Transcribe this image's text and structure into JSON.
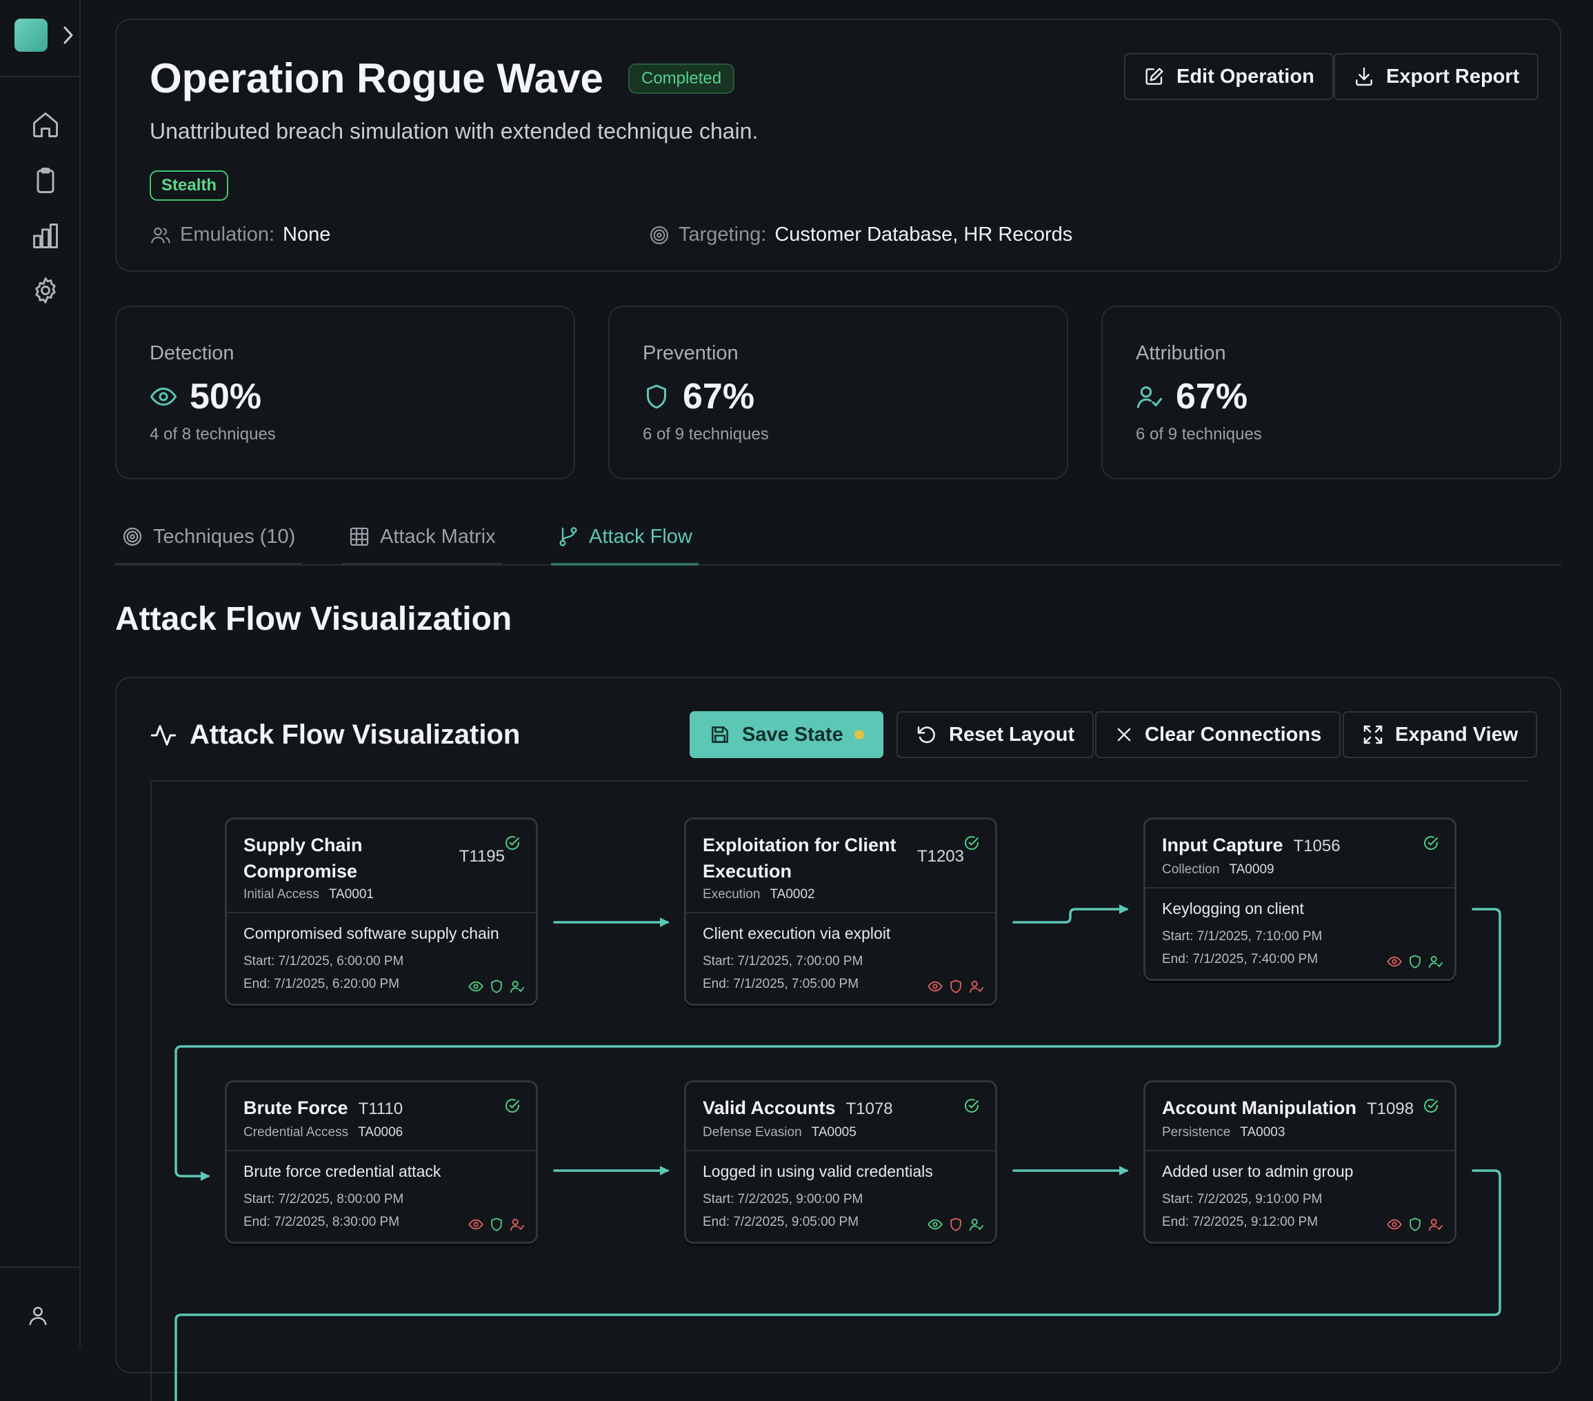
{
  "operation": {
    "title": "Operation Rogue Wave",
    "status": "Completed",
    "description": "Unattributed breach simulation with extended technique chain.",
    "tag": "Stealth",
    "emulation_label": "Emulation:",
    "emulation_value": "None",
    "targeting_label": "Targeting:",
    "targeting_value": "Customer Database, HR Records",
    "edit_label": "Edit Operation",
    "export_label": "Export Report"
  },
  "stats": [
    {
      "label": "Detection",
      "value": "50%",
      "sub": "4 of 8 techniques",
      "icon": "eye-icon"
    },
    {
      "label": "Prevention",
      "value": "67%",
      "sub": "6 of 9 techniques",
      "icon": "shield-icon"
    },
    {
      "label": "Attribution",
      "value": "67%",
      "sub": "6 of 9 techniques",
      "icon": "user-check-icon"
    }
  ],
  "tabs": [
    {
      "label": "Techniques (10)",
      "icon": "target-icon"
    },
    {
      "label": "Attack Matrix",
      "icon": "grid-icon"
    },
    {
      "label": "Attack Flow",
      "icon": "git-branch-icon",
      "active": true
    }
  ],
  "section_title": "Attack Flow Visualization",
  "flow": {
    "title": "Attack Flow Visualization",
    "save_label": "Save State",
    "reset_label": "Reset Layout",
    "clear_label": "Clear Connections",
    "expand_label": "Expand View",
    "nodes": [
      {
        "name": "Supply Chain Compromise",
        "id": "T1195",
        "tactic": "Initial Access",
        "tactic_id": "TA0001",
        "desc": "Compromised software supply chain",
        "start": "Start: 7/1/2025, 6:00:00 PM",
        "end": "End: 7/1/2025, 6:20:00 PM",
        "detect": "green",
        "prevent": "green",
        "attrib": "green"
      },
      {
        "name": "Exploitation for Client Execution",
        "id": "T1203",
        "tactic": "Execution",
        "tactic_id": "TA0002",
        "desc": "Client execution via exploit",
        "start": "Start: 7/1/2025, 7:00:00 PM",
        "end": "End: 7/1/2025, 7:05:00 PM",
        "detect": "red",
        "prevent": "red",
        "attrib": "red"
      },
      {
        "name": "Input Capture",
        "id": "T1056",
        "tactic": "Collection",
        "tactic_id": "TA0009",
        "desc": "Keylogging on client",
        "start": "Start: 7/1/2025, 7:10:00 PM",
        "end": "End: 7/1/2025, 7:40:00 PM",
        "detect": "red",
        "prevent": "green",
        "attrib": "green"
      },
      {
        "name": "Brute Force",
        "id": "T1110",
        "tactic": "Credential Access",
        "tactic_id": "TA0006",
        "desc": "Brute force credential attack",
        "start": "Start: 7/2/2025, 8:00:00 PM",
        "end": "End: 7/2/2025, 8:30:00 PM",
        "detect": "red",
        "prevent": "green",
        "attrib": "red"
      },
      {
        "name": "Valid Accounts",
        "id": "T1078",
        "tactic": "Defense Evasion",
        "tactic_id": "TA0005",
        "desc": "Logged in using valid credentials",
        "start": "Start: 7/2/2025, 9:00:00 PM",
        "end": "End: 7/2/2025, 9:05:00 PM",
        "detect": "green",
        "prevent": "red",
        "attrib": "green"
      },
      {
        "name": "Account Manipulation",
        "id": "T1098",
        "tactic": "Persistence",
        "tactic_id": "TA0003",
        "desc": "Added user to admin group",
        "start": "Start: 7/2/2025, 9:10:00 PM",
        "end": "End: 7/2/2025, 9:12:00 PM",
        "detect": "red",
        "prevent": "green",
        "attrib": "red"
      }
    ]
  },
  "colors": {
    "accent": "#5cc7b5",
    "green": "#4fcf86",
    "red": "#e0605f",
    "bg": "#111418"
  }
}
